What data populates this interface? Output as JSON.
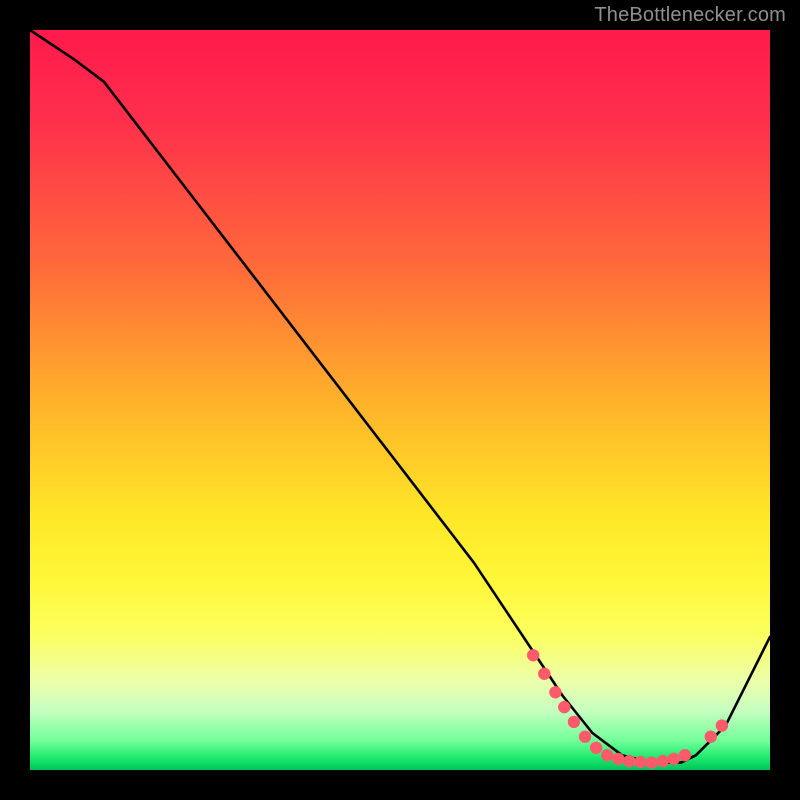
{
  "credit": "TheBottlenecker.com",
  "chart_data": {
    "type": "line",
    "title": "",
    "xlabel": "",
    "ylabel": "",
    "xlim": [
      0,
      100
    ],
    "ylim": [
      0,
      100
    ],
    "series": [
      {
        "name": "bottleneck-curve",
        "x": [
          0,
          6,
          10,
          20,
          30,
          40,
          50,
          60,
          68,
          72,
          76,
          80,
          84,
          88,
          90,
          94,
          98,
          100
        ],
        "y": [
          100,
          96,
          93,
          80,
          67,
          54,
          41,
          28,
          16,
          10,
          5,
          2,
          1,
          1,
          2,
          6,
          14,
          18
        ]
      }
    ],
    "markers": [
      {
        "name": "marker-cluster",
        "color": "#ff5a6a",
        "points": [
          {
            "x": 68.0,
            "y": 15.5
          },
          {
            "x": 69.5,
            "y": 13.0
          },
          {
            "x": 71.0,
            "y": 10.5
          },
          {
            "x": 72.2,
            "y": 8.5
          },
          {
            "x": 73.5,
            "y": 6.5
          },
          {
            "x": 75.0,
            "y": 4.5
          },
          {
            "x": 76.5,
            "y": 3.0
          },
          {
            "x": 78.0,
            "y": 2.0
          },
          {
            "x": 79.5,
            "y": 1.5
          },
          {
            "x": 81.0,
            "y": 1.2
          },
          {
            "x": 82.5,
            "y": 1.1
          },
          {
            "x": 84.0,
            "y": 1.0
          },
          {
            "x": 85.5,
            "y": 1.2
          },
          {
            "x": 87.0,
            "y": 1.5
          },
          {
            "x": 88.5,
            "y": 2.0
          },
          {
            "x": 92.0,
            "y": 4.5
          },
          {
            "x": 93.5,
            "y": 6.0
          }
        ]
      }
    ],
    "gradient_stops": [
      {
        "pos": 0,
        "color": "#ff1a4b"
      },
      {
        "pos": 0.5,
        "color": "#ffe827"
      },
      {
        "pos": 0.98,
        "color": "#17e86a"
      },
      {
        "pos": 1.0,
        "color": "#00c45a"
      }
    ]
  }
}
